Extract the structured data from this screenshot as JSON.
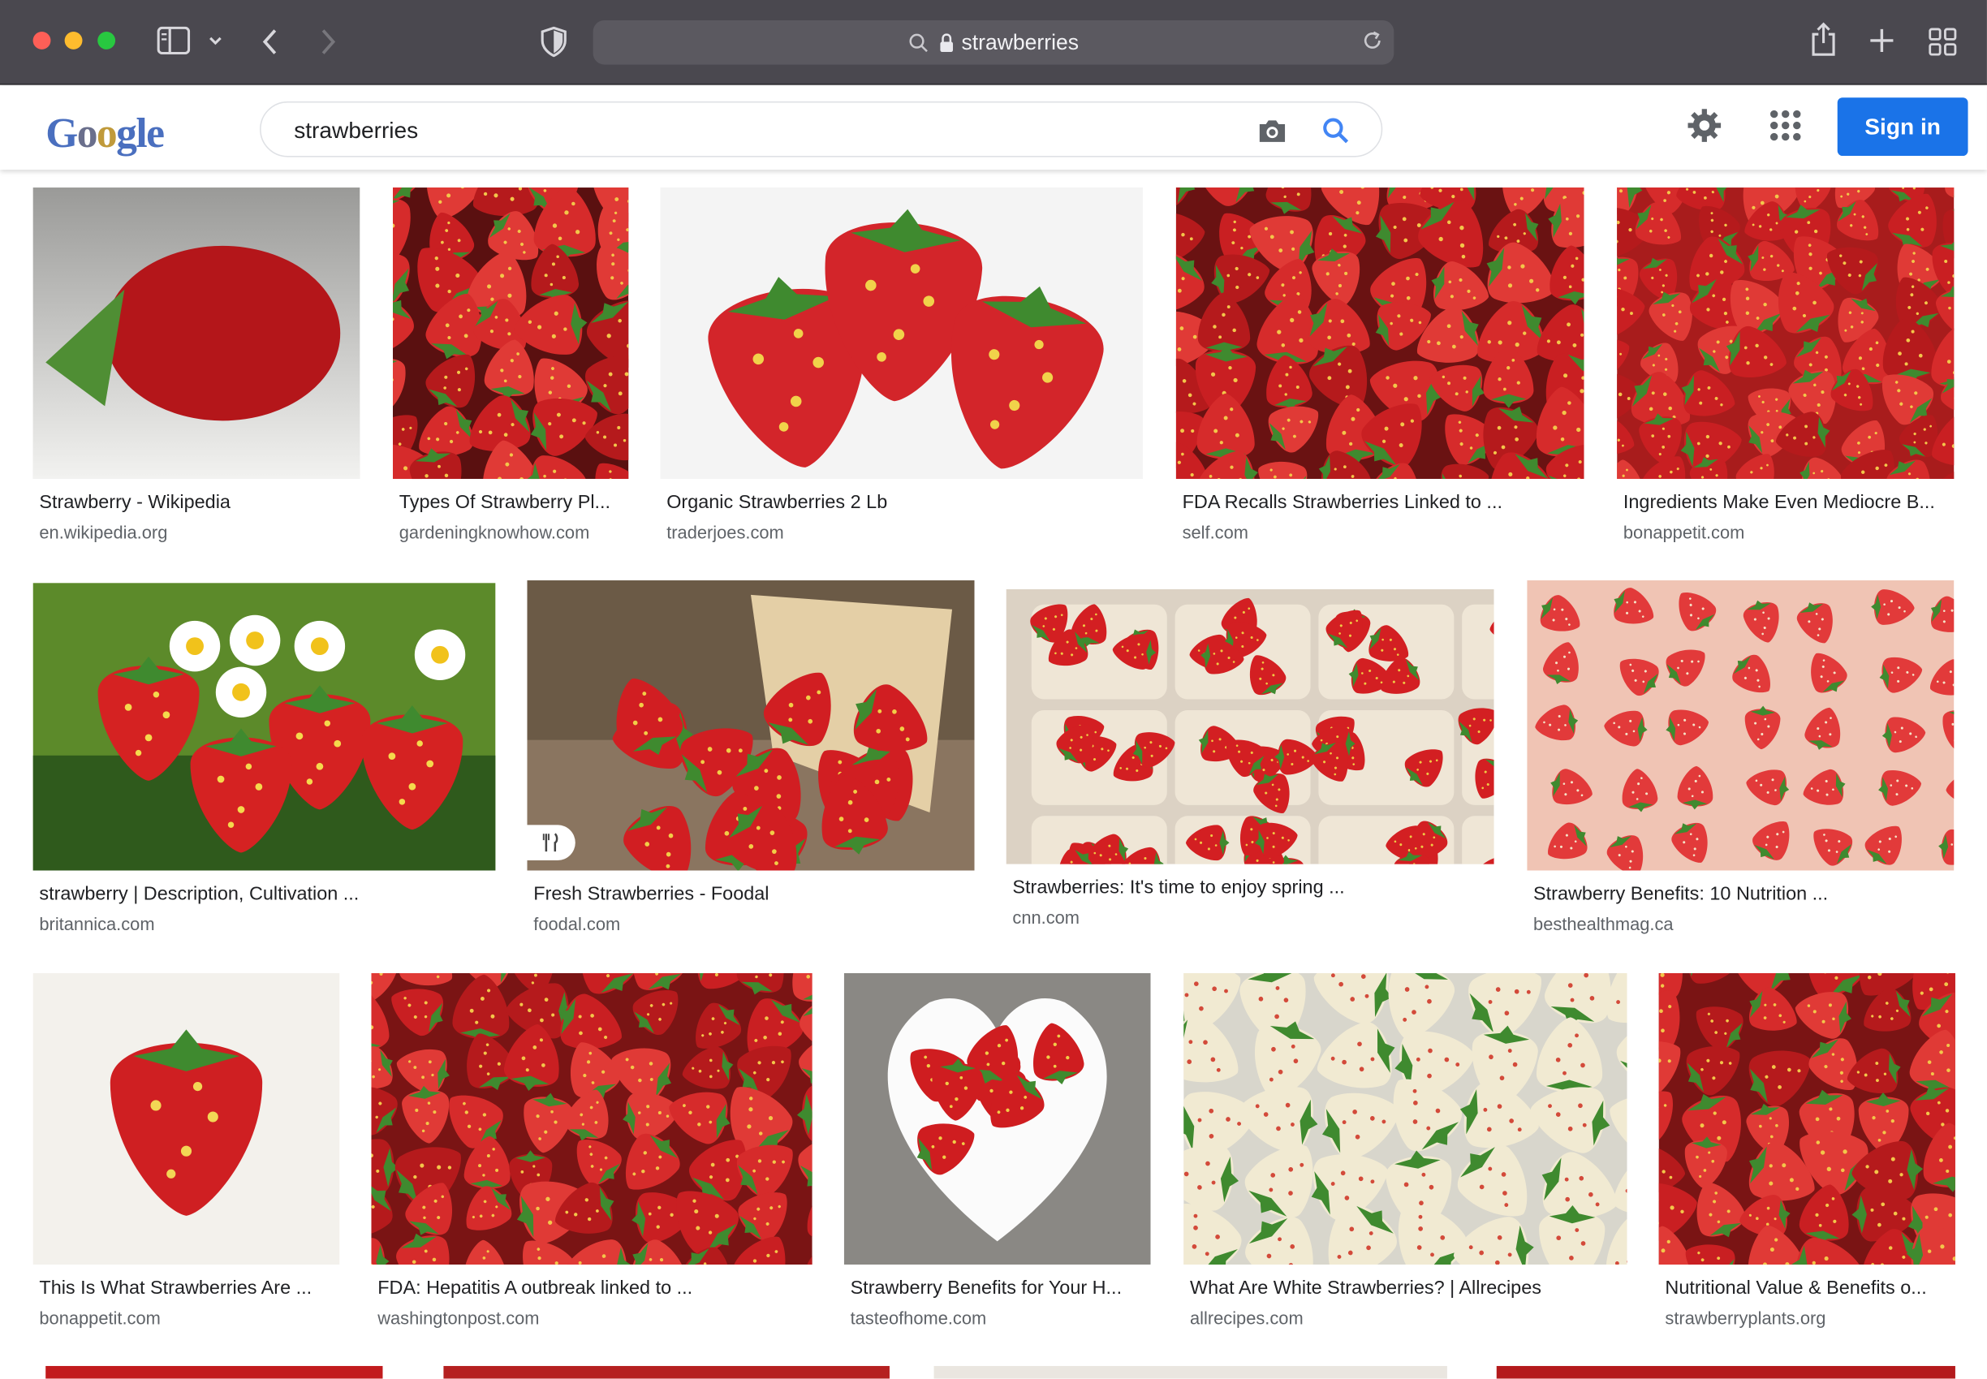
{
  "browser": {
    "address": "strawberries"
  },
  "google": {
    "logo_letters": [
      "G",
      "o",
      "o",
      "g",
      "l",
      "e"
    ],
    "query": "strawberries",
    "signin_label": "Sign in"
  },
  "results": [
    {
      "title": "Strawberry - Wikipedia",
      "site": "en.wikipedia.org"
    },
    {
      "title": "Types Of Strawberry Pl...",
      "site": "gardeningknowhow.com"
    },
    {
      "title": "Organic Strawberries 2 Lb",
      "site": "traderjoes.com"
    },
    {
      "title": "FDA Recalls Strawberries Linked to ...",
      "site": "self.com"
    },
    {
      "title": "Ingredients Make Even Mediocre B...",
      "site": "bonappetit.com"
    },
    {
      "title": "strawberry | Description, Cultivation ...",
      "site": "britannica.com"
    },
    {
      "title": "Fresh Strawberries - Foodal",
      "site": "foodal.com"
    },
    {
      "title": "Strawberries: It's time to enjoy spring ...",
      "site": "cnn.com"
    },
    {
      "title": "Strawberry Benefits: 10 Nutrition ...",
      "site": "besthealthmag.ca"
    },
    {
      "title": "This Is What Strawberries Are ...",
      "site": "bonappetit.com"
    },
    {
      "title": "FDA: Hepatitis A outbreak linked to ...",
      "site": "washingtonpost.com"
    },
    {
      "title": "Strawberry Benefits for Your H...",
      "site": "tasteofhome.com"
    },
    {
      "title": "What Are White Strawberries? | Allrecipes",
      "site": "allrecipes.com"
    },
    {
      "title": "Nutritional Value & Benefits o...",
      "site": "strawberryplants.org"
    }
  ],
  "icons": {
    "sidebar": "sidebar-icon",
    "back": "chevron-left-icon",
    "forward": "chevron-right-icon",
    "shield": "shield-icon",
    "lock": "lock-icon",
    "reload": "reload-icon",
    "share": "share-icon",
    "newtab": "plus-icon",
    "tabs": "grid-icon",
    "camera": "camera-icon",
    "search": "search-icon",
    "settings": "gear-icon",
    "apps": "apps-icon",
    "recipe": "fork-knife-icon"
  },
  "colors": {
    "accent": "#1a73e8",
    "berry": "#d22a2a",
    "leaf": "#3f8a2f"
  }
}
